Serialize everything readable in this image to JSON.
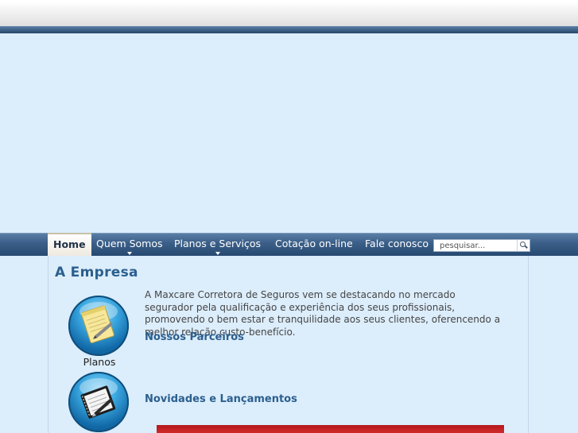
{
  "nav": {
    "items": [
      {
        "label": "Home",
        "active": true,
        "has_dropdown": false
      },
      {
        "label": "Quem Somos",
        "active": false,
        "has_dropdown": true
      },
      {
        "label": "Planos e Serviços",
        "active": false,
        "has_dropdown": true
      },
      {
        "label": "Cotação on-line",
        "active": false,
        "has_dropdown": false
      },
      {
        "label": "Fale conosco",
        "active": false,
        "has_dropdown": false
      }
    ]
  },
  "search": {
    "placeholder": "pesquisar...",
    "icon": "magnifier-icon"
  },
  "content": {
    "title": "A Empresa",
    "intro": "A Maxcare Corretora de Seguros vem se destacando no mercado segurador pela qualificação e experiência dos seus profissionais, promovendo o bem estar e tranquilidade aos seus clientes, oferencendo a melhor relação custo-benefício.",
    "plans_label": "Planos",
    "plans_icon": "notepad-pencil-icon",
    "news_icon": "notebook-pen-icon",
    "partners_heading": "Nossos Parceiros",
    "news_heading": "Novidades e Lançamentos"
  },
  "colors": {
    "page_background": "#dcedfb",
    "navbar": "#2f5480",
    "heading": "#2b5f8f",
    "banner": "#c41f22"
  }
}
